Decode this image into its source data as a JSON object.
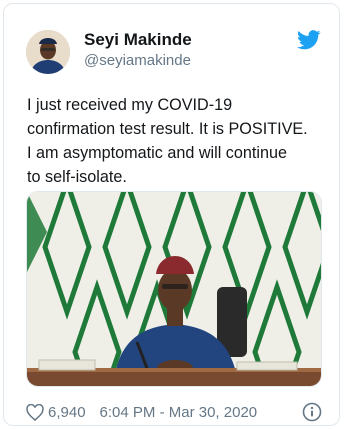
{
  "tweet": {
    "author_name": "Seyi Makinde",
    "author_handle": "@seyiamakinde",
    "text_lines": [
      "I just received my COVID-19",
      "confirmation test result. It is POSITIVE.",
      "I am asymptomatic and will continue",
      "to self-isolate."
    ],
    "like_count": "6,940",
    "timestamp": "6:04 PM - Mar 30, 2020"
  },
  "icons": {
    "brand": "twitter-bird-icon",
    "like": "heart-icon",
    "info": "info-icon"
  },
  "colors": {
    "brand_blue": "#1da1f2",
    "secondary_text": "#657786",
    "wall_green": "#1f7a3a",
    "suit_blue": "#22457f",
    "cap_red": "#8a2a2e"
  }
}
